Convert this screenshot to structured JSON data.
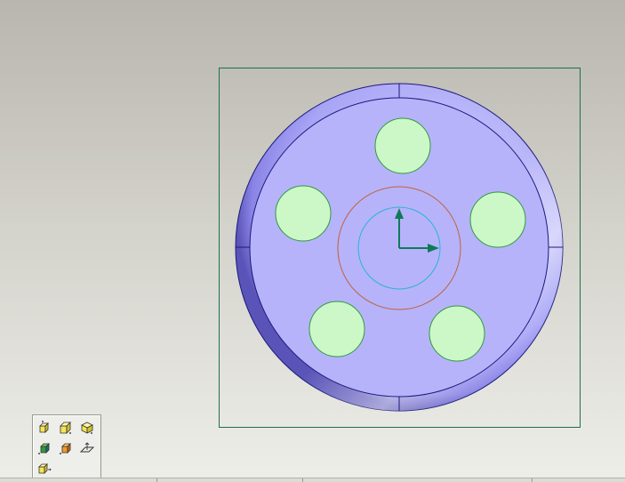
{
  "app": {
    "type": "cad-part-viewer"
  },
  "viewport": {
    "background_gradient": [
      "#b8b6ae",
      "#d2d1ca",
      "#eeeee9"
    ],
    "part": {
      "description_icon": "circular-disc-part",
      "body_color": "#b6b3fb",
      "rim_color": "#8f8ae8",
      "edge_color": "#1a1a7a",
      "hole_fill": "#ccf8c8",
      "hole_stroke": "#2e9a3a",
      "hole_count": 5,
      "hub_outer_circle_color": "#c0623a",
      "hub_inner_circle_color": "#2ab3d8"
    },
    "origin_triad": {
      "color": "#0d7a5a",
      "icon": "coordinate-axes-icon"
    },
    "bounding_frame_color": "#1f6f4f"
  },
  "view_toolbar": {
    "buttons": [
      {
        "name": "front-view-button",
        "icon": "cube-front-icon"
      },
      {
        "name": "top-view-button",
        "icon": "cube-top-icon"
      },
      {
        "name": "iso-view-button",
        "icon": "cube-iso-icon"
      },
      {
        "name": "shaded-view-button",
        "icon": "cube-shaded-icon"
      },
      {
        "name": "perspective-view-button",
        "icon": "cube-orange-icon"
      },
      {
        "name": "plane-view-button",
        "icon": "plane-icon"
      },
      {
        "name": "normal-to-view-button",
        "icon": "cube-normal-icon"
      }
    ]
  }
}
